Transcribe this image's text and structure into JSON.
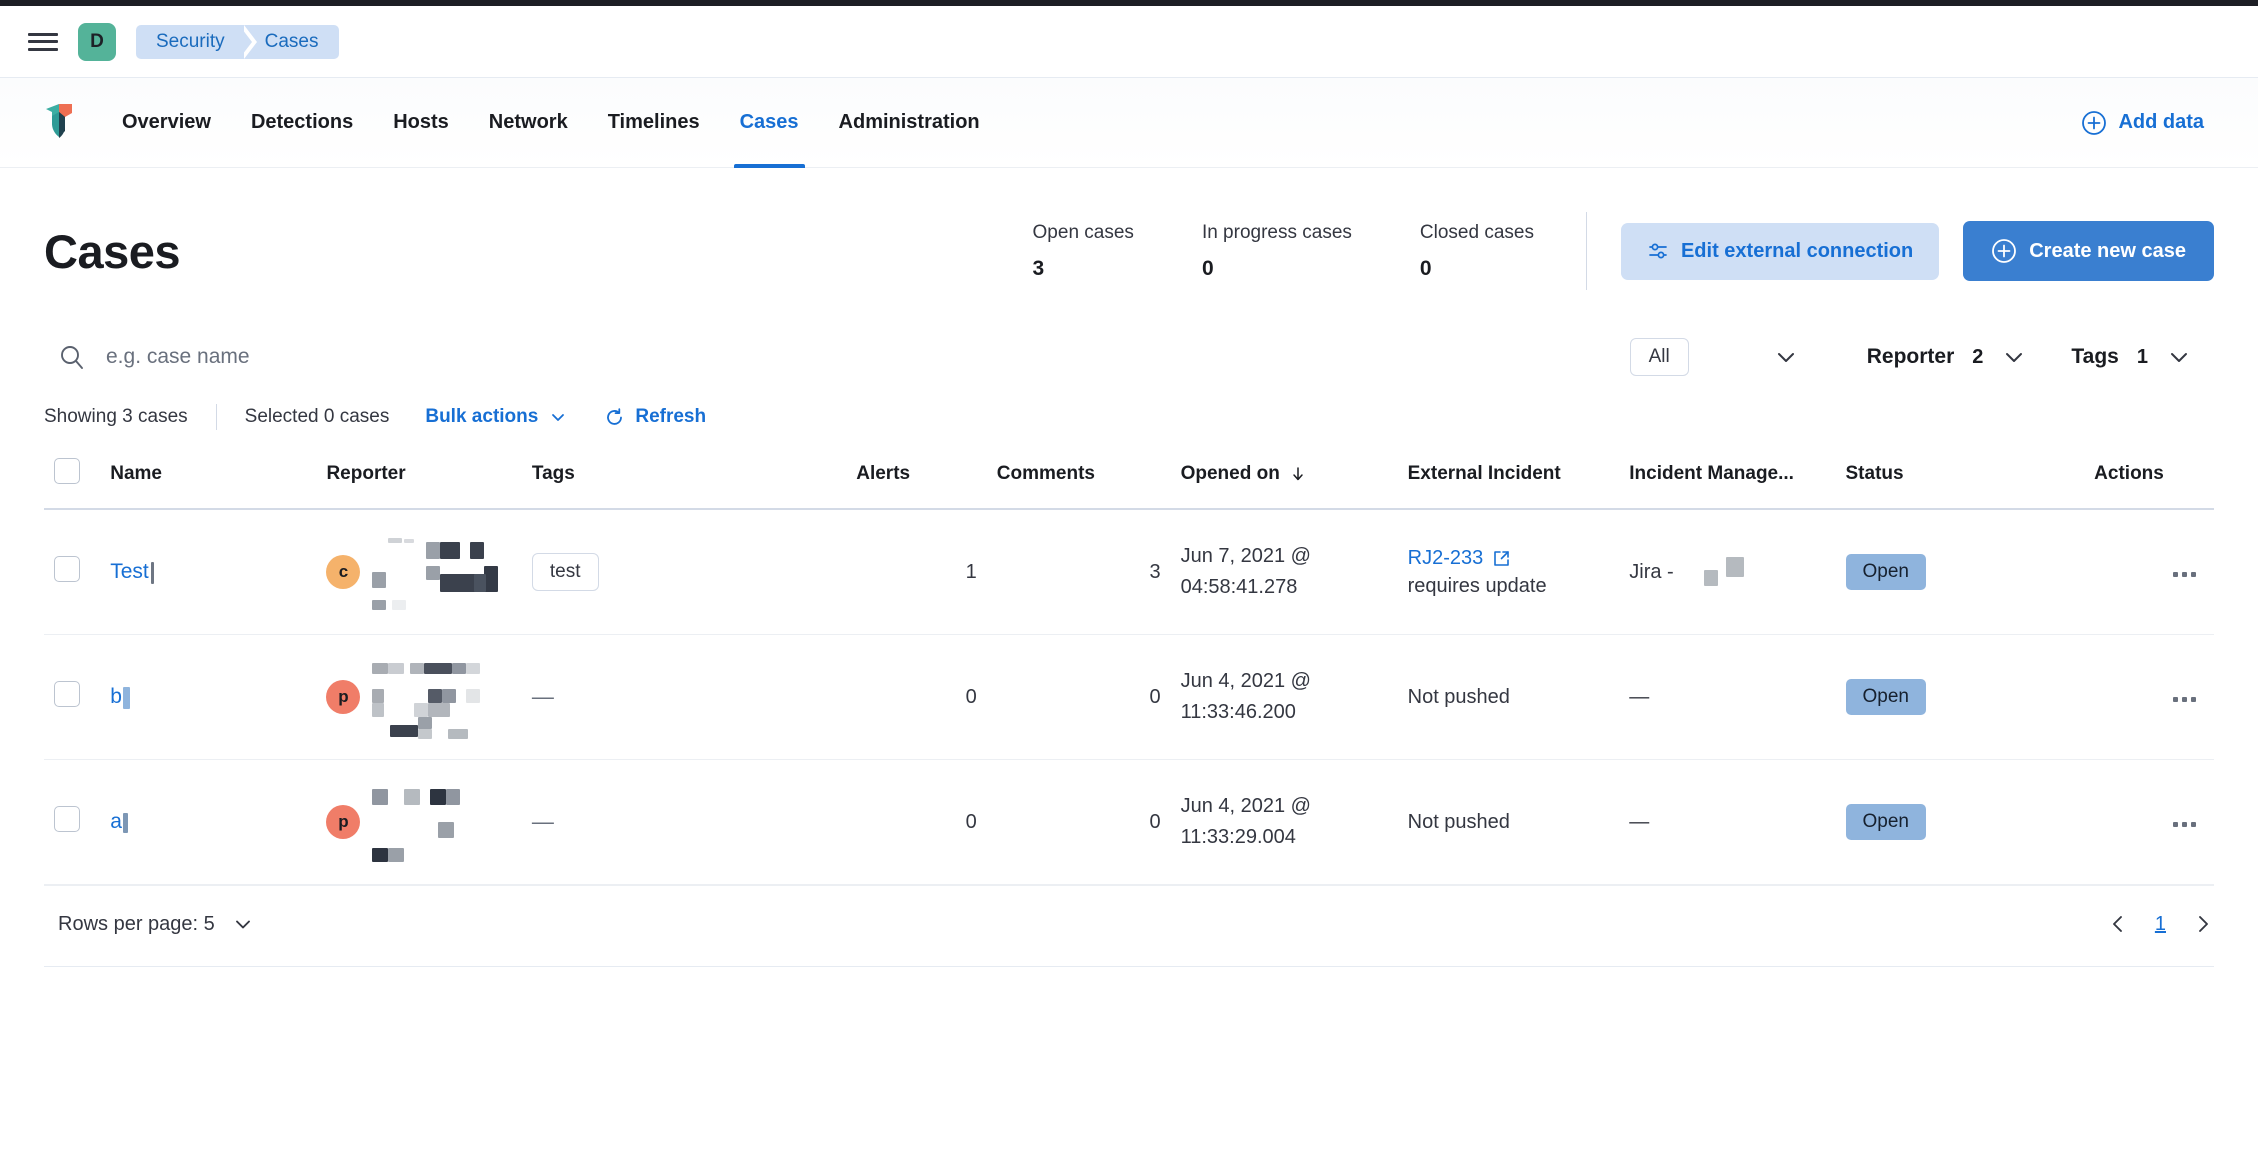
{
  "chrome": {
    "menu_icon": "hamburger-icon",
    "space_initial": "D"
  },
  "breadcrumbs": [
    {
      "label": "Security"
    },
    {
      "label": "Cases"
    }
  ],
  "app_nav": {
    "logo": "elastic-security-shield-logo",
    "items": [
      {
        "label": "Overview",
        "active": false
      },
      {
        "label": "Detections",
        "active": false
      },
      {
        "label": "Hosts",
        "active": false
      },
      {
        "label": "Network",
        "active": false
      },
      {
        "label": "Timelines",
        "active": false
      },
      {
        "label": "Cases",
        "active": true
      },
      {
        "label": "Administration",
        "active": false
      }
    ],
    "add_data_label": "Add data",
    "add_data_icon": "plus-in-circle-icon"
  },
  "page": {
    "title": "Cases",
    "stats": [
      {
        "label": "Open cases",
        "value": "3"
      },
      {
        "label": "In progress cases",
        "value": "0"
      },
      {
        "label": "Closed cases",
        "value": "0"
      }
    ],
    "edit_connection_label": "Edit external connection",
    "edit_connection_icon": "sliders-icon",
    "create_case_label": "Create new case",
    "create_case_icon": "plus-in-circle-icon"
  },
  "filters": {
    "search_icon": "search-icon",
    "search_placeholder": "e.g. case name",
    "search_value": "",
    "status_filter_label": "All",
    "status_chevron_icon": "chevron-down-icon",
    "reporter_label": "Reporter",
    "reporter_count": "2",
    "tags_label": "Tags",
    "tags_count": "1"
  },
  "toolbar": {
    "showing_label": "Showing 3 cases",
    "selected_label": "Selected 0 cases",
    "bulk_actions_label": "Bulk actions",
    "bulk_chevron_icon": "chevron-down-icon",
    "refresh_label": "Refresh",
    "refresh_icon": "refresh-icon"
  },
  "table": {
    "select_all_checkbox": "unchecked",
    "columns": [
      "Name",
      "Reporter",
      "Tags",
      "Alerts",
      "Comments",
      "Opened on",
      "External Incident",
      "Incident Manage...",
      "Status",
      "Actions"
    ],
    "sort_column": "Opened on",
    "sort_icon": "arrow-down-icon",
    "rows": [
      {
        "name": "Test",
        "name_redacted": true,
        "reporter_initial": "c",
        "reporter_avatar_color": "#f5b26b",
        "reporter_redacted": true,
        "tags": [
          "test"
        ],
        "alerts": "1",
        "comments": "3",
        "opened_on_date": "Jun 7, 2021 @",
        "opened_on_time": "04:58:41.278",
        "external_incident": "RJ2-233",
        "external_incident_icon": "external-link-icon",
        "external_incident_note": "requires update",
        "incident_management": "Jira -",
        "incident_management_redacted": true,
        "status": "Open",
        "actions_icon": "ellipsis-icon"
      },
      {
        "name": "b",
        "name_redacted": true,
        "reporter_initial": "p",
        "reporter_avatar_color": "#f07d68",
        "reporter_redacted": true,
        "tags": [],
        "tags_empty": "—",
        "alerts": "0",
        "comments": "0",
        "opened_on_date": "Jun 4, 2021 @",
        "opened_on_time": "11:33:46.200",
        "external_incident": "Not pushed",
        "external_incident_note": "",
        "incident_management": "—",
        "status": "Open",
        "actions_icon": "ellipsis-icon"
      },
      {
        "name": "a",
        "name_redacted": true,
        "reporter_initial": "p",
        "reporter_avatar_color": "#f07d68",
        "reporter_redacted": true,
        "tags": [],
        "tags_empty": "—",
        "alerts": "0",
        "comments": "0",
        "opened_on_date": "Jun 4, 2021 @",
        "opened_on_time": "11:33:29.004",
        "external_incident": "Not pushed",
        "external_incident_note": "",
        "incident_management": "—",
        "status": "Open",
        "actions_icon": "ellipsis-icon"
      }
    ]
  },
  "footer": {
    "rows_per_page_label": "Rows per page: 5",
    "rows_per_page_icon": "chevron-down-icon",
    "prev_icon": "chevron-left-icon",
    "page_number": "1",
    "next_icon": "chevron-right-icon"
  },
  "colors": {
    "accent_blue": "#176fd4",
    "primary_button": "#3a7fd0",
    "secondary_button": "#cfdff5",
    "space_avatar": "#54b399",
    "status_open": "#8fb4dd"
  }
}
